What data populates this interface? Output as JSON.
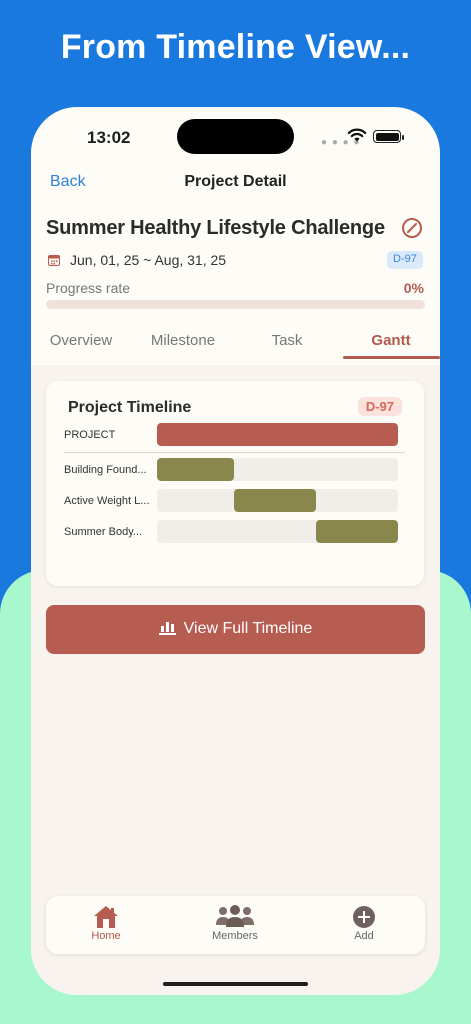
{
  "headline": "From Timeline View...",
  "status_bar": {
    "time": "13:02"
  },
  "nav": {
    "back_label": "Back",
    "title": "Project Detail"
  },
  "project": {
    "title": "Summer Healthy Lifestyle Challenge",
    "date_range": "Jun, 01, 25 ~ Aug, 31, 25",
    "dday_badge": "D-97",
    "progress_label": "Progress rate",
    "progress_value": "0%",
    "progress_fraction": 0
  },
  "tabs": [
    {
      "label": "Overview",
      "active": false
    },
    {
      "label": "Milestone",
      "active": false
    },
    {
      "label": "Task",
      "active": false
    },
    {
      "label": "Gantt",
      "active": true
    }
  ],
  "timeline_card": {
    "title": "Project Timeline",
    "dday_badge": "D-97",
    "rows": [
      {
        "label": "PROJECT",
        "start_fraction": 0.0,
        "end_fraction": 1.0,
        "kind": "project"
      },
      {
        "label": "Building Found...",
        "start_fraction": 0.0,
        "end_fraction": 0.32,
        "kind": "milestone"
      },
      {
        "label": "Active Weight L...",
        "start_fraction": 0.32,
        "end_fraction": 0.66,
        "kind": "milestone"
      },
      {
        "label": "Summer Body...",
        "start_fraction": 0.66,
        "end_fraction": 1.0,
        "kind": "milestone"
      }
    ]
  },
  "cta": {
    "label": "View Full Timeline",
    "icon": "bar-chart-icon"
  },
  "tabbar": [
    {
      "label": "Home",
      "icon": "home-icon",
      "active": true
    },
    {
      "label": "Members",
      "icon": "members-icon",
      "active": false
    },
    {
      "label": "Add",
      "icon": "add-icon",
      "active": false
    }
  ],
  "colors": {
    "accent": "#b75c50",
    "milestone": "#8a874d",
    "link": "#2f80d8",
    "background_top": "#1a79df",
    "background_bottom": "#a8f7cd"
  }
}
